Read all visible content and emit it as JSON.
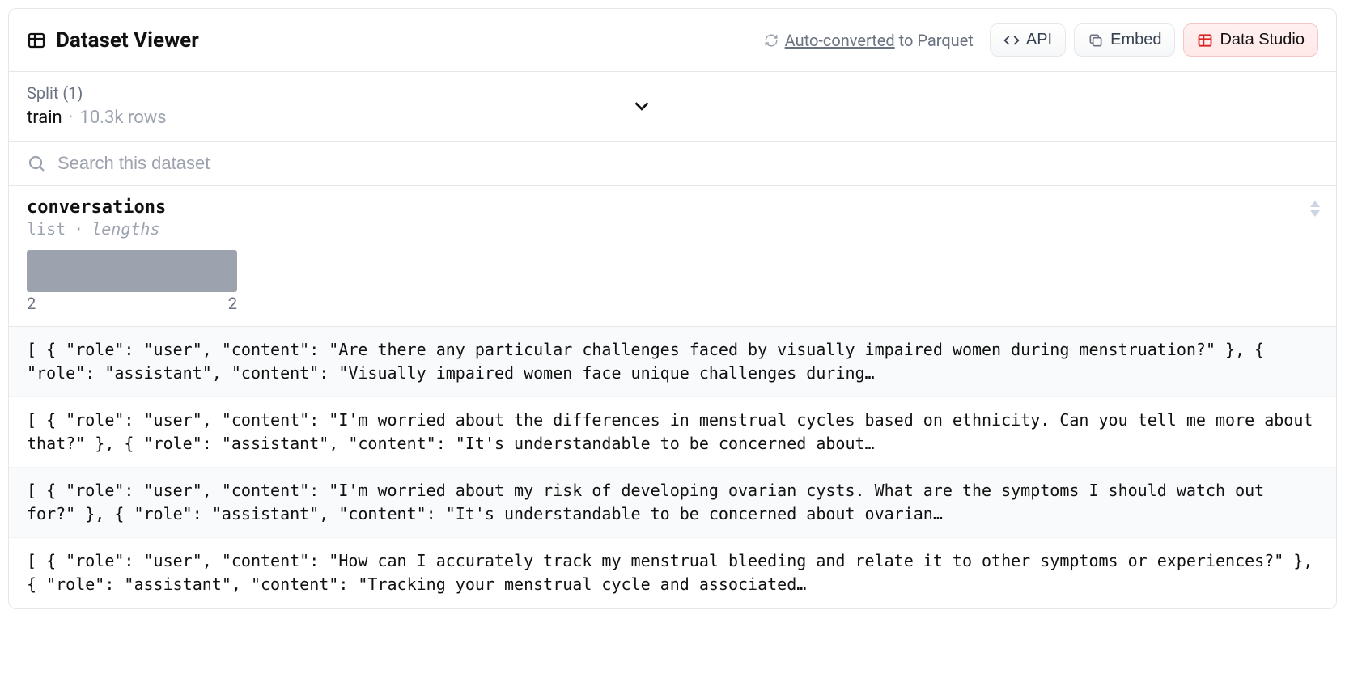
{
  "header": {
    "title": "Dataset Viewer",
    "autoconvert_link": "Auto-converted",
    "autoconvert_suffix": " to Parquet",
    "api_label": "API",
    "embed_label": "Embed",
    "data_studio_label": "Data Studio"
  },
  "split": {
    "label": "Split (1)",
    "name": "train",
    "rows": "10.3k rows"
  },
  "search": {
    "placeholder": "Search this dataset"
  },
  "column": {
    "name": "conversations",
    "type": "list",
    "meta": "lengths",
    "hist_min": "2",
    "hist_max": "2"
  },
  "rows": [
    "[ { \"role\": \"user\", \"content\": \"Are there any particular challenges faced by visually impaired women during menstruation?\" }, { \"role\": \"assistant\", \"content\": \"Visually impaired women face unique challenges during…",
    "[ { \"role\": \"user\", \"content\": \"I'm worried about the differences in menstrual cycles based on ethnicity. Can you tell me more about that?\" }, { \"role\": \"assistant\", \"content\": \"It's understandable to be concerned about…",
    "[ { \"role\": \"user\", \"content\": \"I'm worried about my risk of developing ovarian cysts. What are the symptoms I should watch out for?\" }, { \"role\": \"assistant\", \"content\": \"It's understandable to be concerned about ovarian…",
    "[ { \"role\": \"user\", \"content\": \"How can I accurately track my menstrual bleeding and relate it to other symptoms or experiences?\" }, { \"role\": \"assistant\", \"content\": \"Tracking your menstrual cycle and associated…"
  ]
}
